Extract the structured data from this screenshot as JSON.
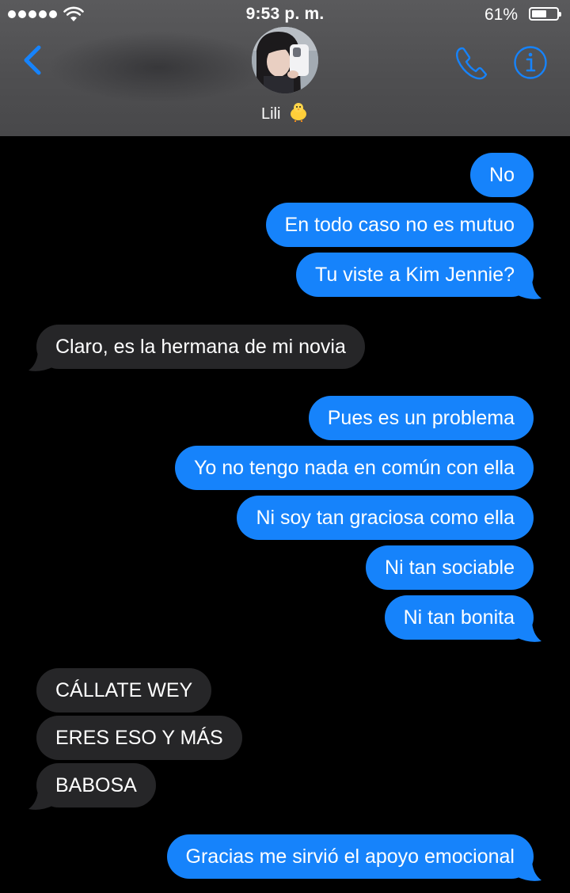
{
  "status_bar": {
    "time": "9:53 p. m.",
    "battery_percent": "61%",
    "battery_level": 0.61,
    "signal_bars": 5,
    "wifi_icon": "wifi-icon"
  },
  "header": {
    "contact_name": "Lili",
    "contact_emoji": "chick-icon",
    "back_icon": "chevron-left-icon",
    "call_icon": "phone-icon",
    "info_icon": "info-icon",
    "accent_color": "#1683fb"
  },
  "messages": [
    {
      "from": "me",
      "text": "No"
    },
    {
      "from": "me",
      "text": "En todo caso no es mutuo"
    },
    {
      "from": "me",
      "text": "Tu viste a Kim Jennie?"
    },
    {
      "from": "them",
      "text": "Claro, es la hermana de mi novia"
    },
    {
      "from": "me",
      "text": "Pues es un problema"
    },
    {
      "from": "me",
      "text": "Yo no tengo nada en común con ella"
    },
    {
      "from": "me",
      "text": "Ni soy tan graciosa como ella"
    },
    {
      "from": "me",
      "text": "Ni tan sociable"
    },
    {
      "from": "me",
      "text": "Ni tan bonita"
    },
    {
      "from": "them",
      "text": "CÁLLATE WEY"
    },
    {
      "from": "them",
      "text": "ERES ESO Y MÁS"
    },
    {
      "from": "them",
      "text": "BABOSA"
    },
    {
      "from": "me",
      "text": "Gracias me sirvió el apoyo emocional"
    }
  ],
  "colors": {
    "sent_bubble": "#1683fb",
    "received_bubble": "#262628",
    "background": "#000000"
  }
}
